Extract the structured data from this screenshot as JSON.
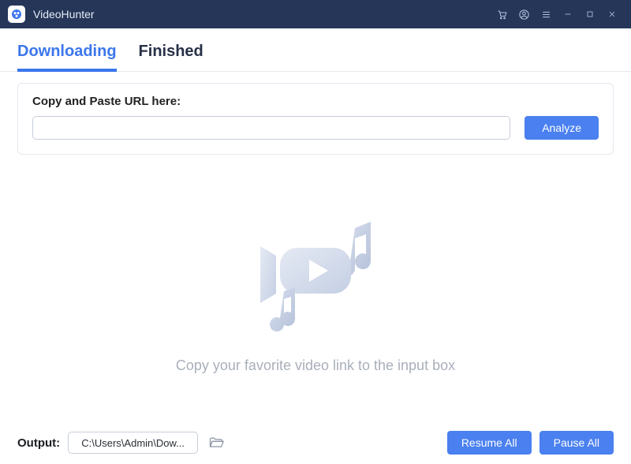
{
  "titlebar": {
    "app_name": "VideoHunter"
  },
  "tabs": {
    "downloading": "Downloading",
    "finished": "Finished",
    "active": "downloading"
  },
  "url_card": {
    "label": "Copy and Paste URL here:",
    "input_value": "",
    "analyze_label": "Analyze"
  },
  "empty_state": {
    "message": "Copy your favorite video link to the input box"
  },
  "footer": {
    "output_label": "Output:",
    "output_path": "C:\\Users\\Admin\\Dow...",
    "resume_all_label": "Resume All",
    "pause_all_label": "Pause All"
  },
  "colors": {
    "titlebar_bg": "#253659",
    "accent": "#4a80ef",
    "tab_active": "#3b76ec",
    "text_muted": "#a9afba"
  }
}
